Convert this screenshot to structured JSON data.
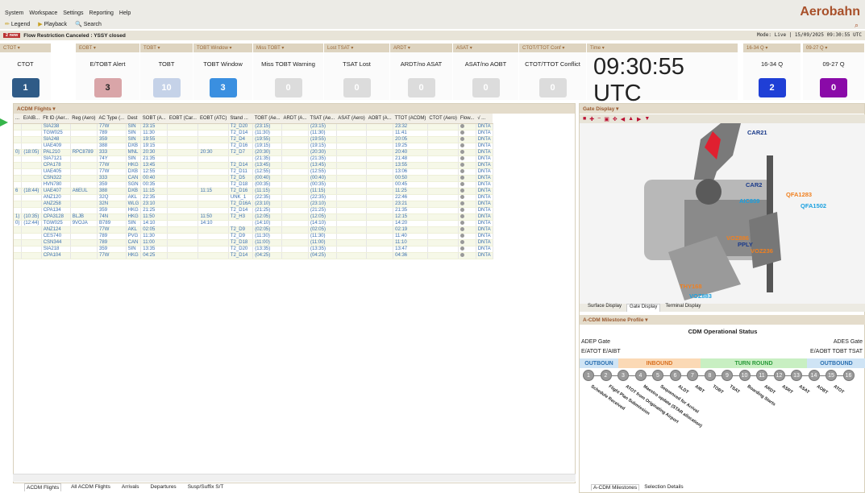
{
  "menu": [
    "System",
    "Workspace",
    "Settings",
    "Reporting",
    "Help"
  ],
  "tools": [
    "Legend",
    "Playback",
    "Search"
  ],
  "brand": "Aerobahn",
  "notice": {
    "tag": "2 new",
    "text": "Flow Restriction Canceled : YSSY closed",
    "mode": "Mode: Live  |  15/09/2025 09:30:55 UTC"
  },
  "kpis": [
    {
      "hdr": "CTOT ▾",
      "label": "CTOT",
      "value": "1",
      "color": "#2f5b87"
    },
    {
      "hdr": "EOBT ▾",
      "label": "E/TOBT Alert",
      "value": "3",
      "color": "#d9a5a8"
    },
    {
      "hdr": "TOBT ▾",
      "label": "TOBT",
      "value": "10",
      "color": "#c5d2e8"
    },
    {
      "hdr": "TOBT Window ▾",
      "label": "TOBT Window",
      "value": "3",
      "color": "#3a8fe0"
    },
    {
      "hdr": "Miss TOBT ▾",
      "label": "Miss TOBT Warning",
      "value": "0",
      "color": "#dcdcdc"
    },
    {
      "hdr": "Lost TSAT ▾",
      "label": "TSAT Lost",
      "value": "0",
      "color": "#dcdcdc"
    },
    {
      "hdr": "ARDT ▾",
      "label": "ARDT/no ASAT",
      "value": "0",
      "color": "#dcdcdc"
    },
    {
      "hdr": "ASAT ▾",
      "label": "ASAT/no AOBT",
      "value": "0",
      "color": "#dcdcdc"
    },
    {
      "hdr": "CTOT/TTOT Conf ▾",
      "label": "CTOT/TTOT Conflict",
      "value": "0",
      "color": "#dcdcdc"
    },
    {
      "hdr": "16-34 Q ▾",
      "label": "16-34 Q",
      "value": "2",
      "color": "#1f3fd6"
    },
    {
      "hdr": "09-27 Q ▾",
      "label": "09-27 Q",
      "value": "0",
      "color": "#8a0aa8"
    }
  ],
  "time": {
    "hdr": "Time ▾",
    "value": "09:30:55 UTC"
  },
  "flights": {
    "title": "ACDM Flights ▾",
    "columns": [
      "...",
      "E/AIB...",
      "Flt ID (Aer...",
      "Reg (Aero)",
      "AC Type (...",
      "Dest",
      "SOBT (A...",
      "EOBT (Car...",
      "EOBT (ATC)",
      "Stand ...",
      "TOBT (Ae...",
      "ARDT (A...",
      "TSAT (Ae...",
      "ASAT (Aero)",
      "AOBT (A...",
      "TTOT (ACDM)",
      "CTOT (Aero)",
      "Flow...",
      "√ ..."
    ],
    "rows": [
      [
        "",
        "",
        "SIA238",
        "",
        "77W",
        "SIN",
        "23:15",
        "",
        "",
        "T2_D20",
        "(23:15)",
        "",
        "(23:15)",
        "",
        "",
        "23:32",
        "",
        "",
        "DNTA"
      ],
      [
        "",
        "",
        "TGW025",
        "",
        "789",
        "SIN",
        "11:30",
        "",
        "",
        "T2_D14",
        "(11:30)",
        "",
        "(11:30)",
        "",
        "",
        "11:41",
        "",
        "",
        "DNTA"
      ],
      [
        "",
        "",
        "SIA248",
        "",
        "359",
        "SIN",
        "19:55",
        "",
        "",
        "T2_D4",
        "(19:55)",
        "",
        "(19:55)",
        "",
        "",
        "20:05",
        "",
        "",
        "DNTA"
      ],
      [
        "",
        "",
        "UAE409",
        "",
        "388",
        "DXB",
        "19:15",
        "",
        "",
        "T2_D16",
        "(19:15)",
        "",
        "(19:15)",
        "",
        "",
        "19:25",
        "",
        "",
        "DNTA"
      ],
      [
        "0)",
        "(18:05)",
        "PAL210",
        "RPC8789",
        "333",
        "MNL",
        "20:30",
        "",
        "20:30",
        "T2_D7",
        "(20:30)",
        "",
        "(20:30)",
        "",
        "",
        "20:40",
        "",
        "",
        "DNTA"
      ],
      [
        "",
        "",
        "SIA7121",
        "",
        "74Y",
        "SIN",
        "21:35",
        "",
        "",
        "",
        "(21:35)",
        "",
        "(21:35)",
        "",
        "",
        "21:48",
        "",
        "",
        "DNTA"
      ],
      [
        "",
        "",
        "CPA178",
        "",
        "77W",
        "HKG",
        "13:45",
        "",
        "",
        "T2_D14",
        "(13:45)",
        "",
        "(13:45)",
        "",
        "",
        "13:55",
        "",
        "",
        "DNTA"
      ],
      [
        "",
        "",
        "UAE405",
        "",
        "77W",
        "DXB",
        "12:55",
        "",
        "",
        "T2_D11",
        "(12:55)",
        "",
        "(12:55)",
        "",
        "",
        "13:06",
        "",
        "",
        "DNTA"
      ],
      [
        "",
        "",
        "CSN322",
        "",
        "333",
        "CAN",
        "00:40",
        "",
        "",
        "T2_D5",
        "(00:40)",
        "",
        "(00:40)",
        "",
        "",
        "00:50",
        "",
        "",
        "DNTA"
      ],
      [
        "",
        "",
        "HVN780",
        "",
        "359",
        "SGN",
        "00:35",
        "",
        "",
        "T2_D18",
        "(00:35)",
        "",
        "(00:35)",
        "",
        "",
        "00:45",
        "",
        "",
        "DNTA"
      ],
      [
        "6",
        "(18:44)",
        "UAE407",
        "A6EUL",
        "388",
        "DXB",
        "11:15",
        "",
        "11:15",
        "T2_D16",
        "(11:15)",
        "",
        "(11:15)",
        "",
        "",
        "11:25",
        "",
        "",
        "DNTA"
      ],
      [
        "",
        "",
        "ANZ120",
        "",
        "32Q",
        "AKL",
        "22:35",
        "",
        "",
        "UNK_1",
        "(22:35)",
        "",
        "(22:35)",
        "",
        "",
        "22:46",
        "",
        "",
        "DNTA"
      ],
      [
        "",
        "",
        "ANZ258",
        "",
        "32N",
        "WLG",
        "23:10",
        "",
        "",
        "T2_D16A",
        "(23:10)",
        "",
        "(23:10)",
        "",
        "",
        "23:21",
        "",
        "",
        "DNTA"
      ],
      [
        "",
        "",
        "CPA134",
        "",
        "359",
        "HKG",
        "21:25",
        "",
        "",
        "T2_D14",
        "(21:25)",
        "",
        "(21:25)",
        "",
        "",
        "21:35",
        "",
        "",
        "DNTA"
      ],
      [
        "1)",
        "(10:35)",
        "CPA3128",
        "BLJB",
        "74N",
        "HKG",
        "11:50",
        "",
        "11:50",
        "T2_H3",
        "(12:05)",
        "",
        "(12:05)",
        "",
        "",
        "12:15",
        "",
        "",
        "DNTA"
      ],
      [
        "0)",
        "(12:44)",
        "TGW025",
        "9VOJA",
        "B789",
        "SIN",
        "14:10",
        "",
        "14:10",
        "",
        "(14:10)",
        "",
        "(14:10)",
        "",
        "",
        "14:20",
        "",
        "",
        "DNTA"
      ],
      [
        "",
        "",
        "ANZ124",
        "",
        "77W",
        "AKL",
        "02:05",
        "",
        "",
        "T2_D9",
        "(02:05)",
        "",
        "(02:05)",
        "",
        "",
        "02:19",
        "",
        "",
        "DNTA"
      ],
      [
        "",
        "",
        "CES740",
        "",
        "789",
        "PVG",
        "11:30",
        "",
        "",
        "T2_D9",
        "(11:30)",
        "",
        "(11:30)",
        "",
        "",
        "11:40",
        "",
        "",
        "DNTA"
      ],
      [
        "",
        "",
        "CSN344",
        "",
        "789",
        "CAN",
        "11:00",
        "",
        "",
        "T2_D18",
        "(11:00)",
        "",
        "(11:00)",
        "",
        "",
        "11:10",
        "",
        "",
        "DNTA"
      ],
      [
        "",
        "",
        "SIA218",
        "",
        "359",
        "SIN",
        "13:35",
        "",
        "",
        "T2_D20",
        "(13:35)",
        "",
        "(13:35)",
        "",
        "",
        "13:47",
        "",
        "",
        "DNTA"
      ],
      [
        "",
        "",
        "CPA104",
        "",
        "77W",
        "HKG",
        "04:25",
        "",
        "",
        "T2_D14",
        "(04:25)",
        "",
        "(04:25)",
        "",
        "",
        "04:36",
        "",
        "",
        "DNTA"
      ]
    ]
  },
  "bottom_tabs": [
    "ACDM Flights",
    "All ACDM Flights",
    "Arrivals",
    "Departures",
    "Susp/Suffix S/T"
  ],
  "gate": {
    "title": "Gate Display ▾",
    "tags": [
      {
        "t": "CAR21",
        "c": "#1a3a8a"
      },
      {
        "t": "CAR2",
        "c": "#1a3a8a"
      },
      {
        "t": "QFA1283",
        "c": "#f08020"
      },
      {
        "t": "QFA1502",
        "c": "#1aa0e0"
      },
      {
        "t": "AIC809",
        "c": "#1aa0e0"
      },
      {
        "t": "VOZ886",
        "c": "#f08020"
      },
      {
        "t": "PPLY",
        "c": "#1a3a8a"
      },
      {
        "t": "VOZ236",
        "c": "#f08020"
      },
      {
        "t": "THY168",
        "c": "#f08020"
      },
      {
        "t": "VOZ883",
        "c": "#1aa0e0"
      }
    ],
    "tabs": [
      "Surface Display",
      "Gate Display",
      "Terminal Display"
    ]
  },
  "milestones": {
    "title": "A-CDM Milestone Profile ▾",
    "status": "CDM Operational Status",
    "adep": "ADEP  Gate",
    "ades": "ADES  Gate",
    "left2": "E/ATOT  E/AIBT",
    "right2": "E/AOBT  TOBT  TSAT",
    "bands": [
      "OUTBOUN",
      "INBOUND",
      "TURN ROUND",
      "OUTBOUND"
    ],
    "steps": [
      "Schedule Received",
      "Flight Plan Submission",
      "ATOT from Originating Airport",
      "Maestro update (STAR allocation)",
      "Sequenced for Arrival",
      "ALDT",
      "AIBT",
      "TOBT",
      "TSAT",
      "Boarding Starts",
      "ARDT",
      "ASRT",
      "ASAT",
      "AOBT",
      "ATOT"
    ],
    "tabs": [
      "A-CDM Milestones",
      "Selection Details"
    ]
  }
}
